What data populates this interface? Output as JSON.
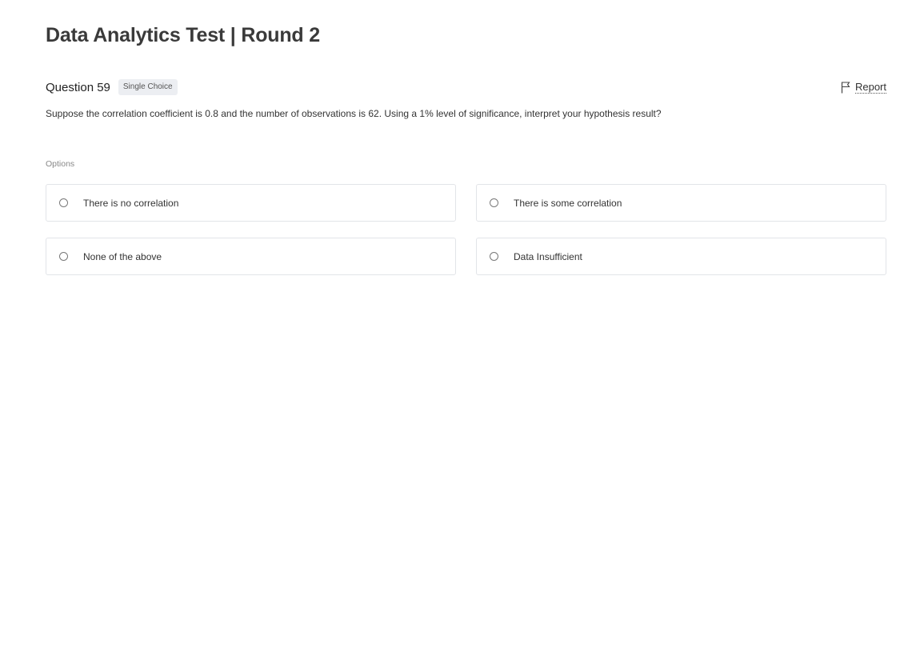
{
  "test": {
    "title": "Data Analytics Test | Round 2"
  },
  "question": {
    "number_label": "Question 59",
    "type_badge": "Single Choice",
    "report_label": "Report",
    "text": "Suppose the correlation coefficient is 0.8 and the number of observations is 62. Using a 1% level of significance, interpret your hypothesis result?"
  },
  "options": {
    "section_label": "Options",
    "items": [
      {
        "label": "There is no correlation",
        "selected": false
      },
      {
        "label": "There is some correlation",
        "selected": false
      },
      {
        "label": "None of the above",
        "selected": false
      },
      {
        "label": "Data Insufficient",
        "selected": false
      }
    ]
  },
  "icons": {
    "report": "flag-icon",
    "option": "radio-icon"
  }
}
